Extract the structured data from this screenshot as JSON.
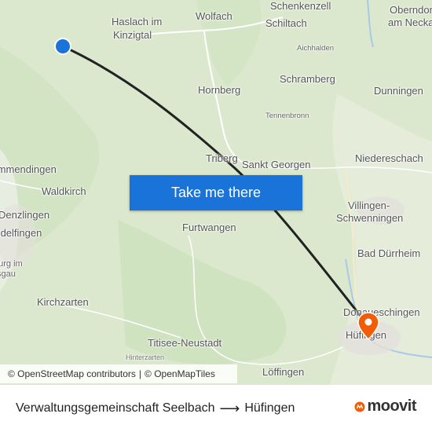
{
  "map": {
    "places": [
      {
        "name": "Haslach im\nKinzigtal",
        "size": "normal"
      },
      {
        "name": "Wolfach",
        "size": "normal"
      },
      {
        "name": "Schenkenzell",
        "size": "normal"
      },
      {
        "name": "Schiltach",
        "size": "normal"
      },
      {
        "name": "Oberndorf am Neckar",
        "size": "normal"
      },
      {
        "name": "Aichhalden",
        "size": "small"
      },
      {
        "name": "Schramberg",
        "size": "normal"
      },
      {
        "name": "Hornberg",
        "size": "normal"
      },
      {
        "name": "Dunningen",
        "size": "normal"
      },
      {
        "name": "Tennenbronn",
        "size": "small"
      },
      {
        "name": "Triberg",
        "size": "normal"
      },
      {
        "name": "Sankt Georgen",
        "size": "normal"
      },
      {
        "name": "Niedereschach",
        "size": "normal"
      },
      {
        "name": "Waldkirch",
        "size": "normal"
      },
      {
        "name": "Emmendingen",
        "size": "normal"
      },
      {
        "name": "Denzlingen",
        "size": "normal"
      },
      {
        "name": "Gundelfingen",
        "size": "normal"
      },
      {
        "name": "Freiburg im Breisgau",
        "size": "normal"
      },
      {
        "name": "Furtwangen",
        "size": "normal"
      },
      {
        "name": "Villingen-\nSchwenningen",
        "size": "normal"
      },
      {
        "name": "Bad Dürrheim",
        "size": "normal"
      },
      {
        "name": "Kirchzarten",
        "size": "normal"
      },
      {
        "name": "Donaueschingen",
        "size": "normal"
      },
      {
        "name": "Hüfingen",
        "size": "normal"
      },
      {
        "name": "Titisee-Neustadt",
        "size": "normal"
      },
      {
        "name": "Hinterzarten",
        "size": "tiny"
      },
      {
        "name": "Löffingen",
        "size": "normal"
      }
    ],
    "origin_marker": {
      "label": "Verwaltungsgemeinschaft Seelbach",
      "color": "#1a73d9"
    },
    "destination_marker": {
      "label": "Hüfingen",
      "color": "#f25c05"
    },
    "route_line_color": "#222222",
    "cta_button": "Take me there",
    "attribution": {
      "osm_contributors": "© OpenStreetMap contributors",
      "separator": "|",
      "openmaptiles": "© OpenMapTiles"
    }
  },
  "footer": {
    "origin": "Verwaltungsgemeinschaft Seelbach",
    "arrow": "⟶",
    "destination": "Hüfingen",
    "brand": "moovit",
    "brand_color": "#f25c05"
  }
}
